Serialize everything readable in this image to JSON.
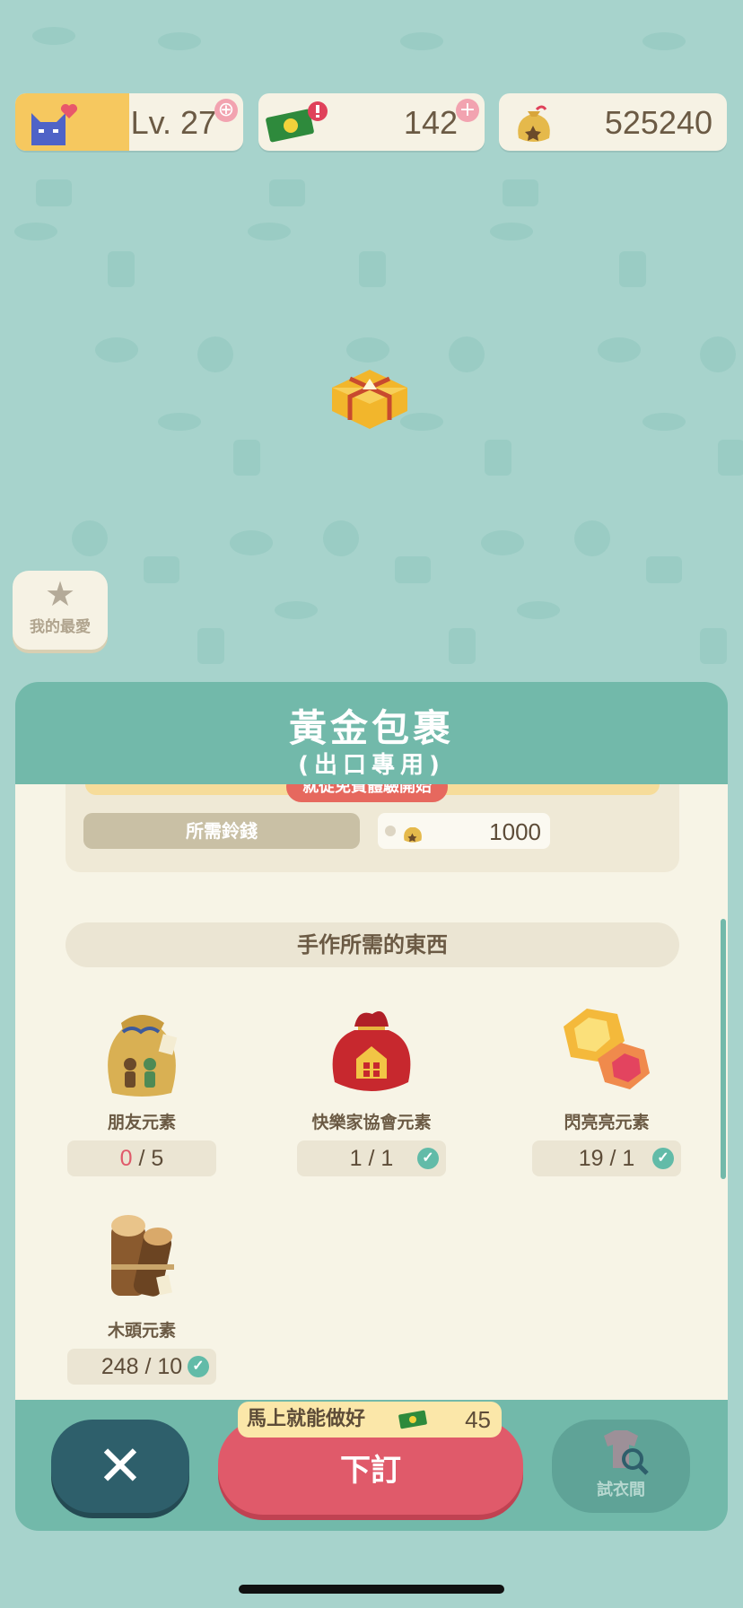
{
  "status_bar": {
    "level": "Lv. 27",
    "tickets": "142",
    "bells": "525240"
  },
  "favorites": {
    "label": "我的最愛"
  },
  "panel": {
    "title": "黃金包裹",
    "subtitle": "(出口專用)",
    "trial_label": "就從免費體驗開始",
    "cost_label": "所需鈴錢",
    "cost_value": "1000",
    "materials_header": "手作所需的東西",
    "materials": [
      {
        "name": "朋友元素",
        "have": "0",
        "need": "/ 5",
        "complete": false
      },
      {
        "name": "快樂家協會元素",
        "have": "1",
        "need": "/ 1",
        "complete": true
      },
      {
        "name": "閃亮亮元素",
        "have": "19",
        "need": "/ 1",
        "complete": true
      },
      {
        "name": "木頭元素",
        "have": "248",
        "need": "/ 10",
        "complete": true
      }
    ]
  },
  "actions": {
    "close_symbol": "✕",
    "order_label": "下訂",
    "instant_label": "馬上就能做好",
    "instant_cost": "45",
    "fitting_label": "試衣間"
  },
  "colors": {
    "background": "#a7d3cc",
    "panel": "#72b9aa",
    "accent_red": "#e05a6a",
    "check": "#62bba8"
  }
}
